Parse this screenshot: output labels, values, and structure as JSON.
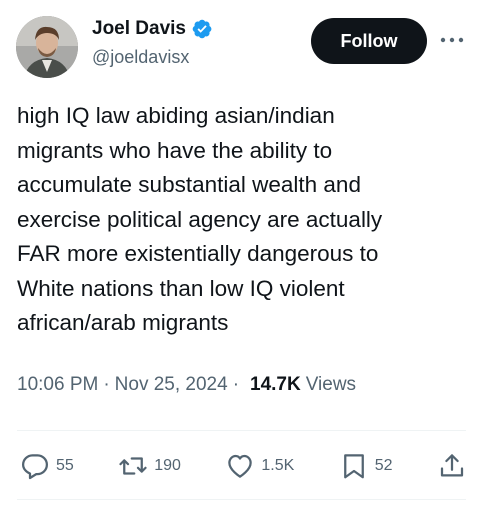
{
  "author": {
    "display_name": "Joel Davis",
    "handle": "@joeldavisx",
    "verified": true,
    "verified_color": "#1d9bf0"
  },
  "header": {
    "follow_label": "Follow",
    "more_icon": "more-horizontal-icon"
  },
  "tweet": {
    "text": "high IQ law abiding asian/indian\nmigrants who have the ability to\naccumulate substantial wealth and\nexercise political agency are actually\nFAR more existentially dangerous to\nWhite nations than low IQ violent\nafrican/arab migrants"
  },
  "meta": {
    "time": "10:06 PM",
    "separator": "·",
    "date": "Nov 25, 2024",
    "views_count": "14.7K",
    "views_label": "Views"
  },
  "actions": {
    "replies": {
      "icon": "reply-icon",
      "count": "55"
    },
    "reposts": {
      "icon": "repost-icon",
      "count": "190"
    },
    "likes": {
      "icon": "like-icon",
      "count": "1.5K"
    },
    "bookmarks": {
      "icon": "bookmark-icon",
      "count": "52"
    },
    "share": {
      "icon": "share-icon"
    }
  },
  "colors": {
    "text_primary": "#0f1419",
    "text_secondary": "#536471",
    "follow_bg": "#0f1419",
    "divider": "#eff3f4"
  }
}
